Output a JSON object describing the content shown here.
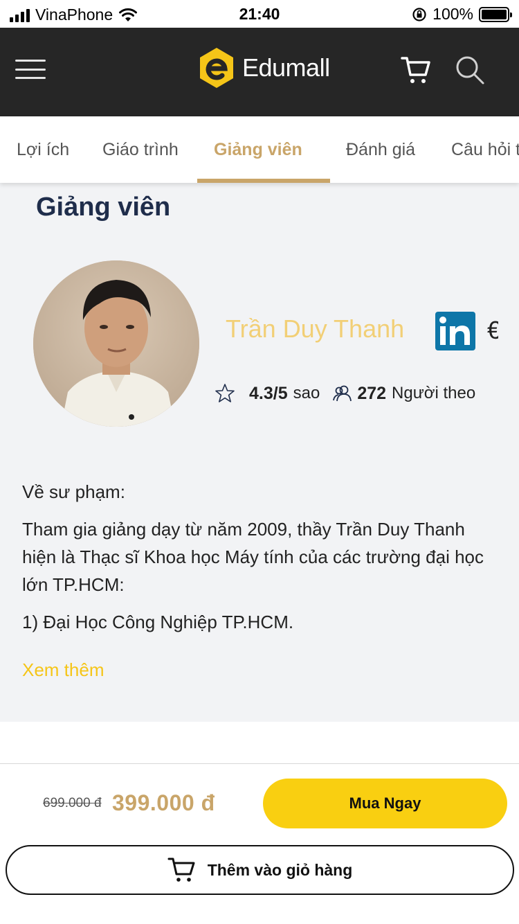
{
  "status_bar": {
    "carrier": "VinaPhone",
    "time": "21:40",
    "battery": "100%",
    "battery_level": 1.0
  },
  "header": {
    "brand": "Edumall",
    "brand_color": "#f5c518",
    "background": "#262626",
    "icons": [
      "menu-icon",
      "cart-icon",
      "search-icon"
    ]
  },
  "tabs": [
    {
      "label": "Lợi ích",
      "active": false
    },
    {
      "label": "Giáo trình",
      "active": false
    },
    {
      "label": "Giảng viên",
      "active": true
    },
    {
      "label": "Đánh giá",
      "active": false
    },
    {
      "label": "Câu hỏi t",
      "active": false
    }
  ],
  "instructor_section": {
    "title": "Giảng viên",
    "name": "Trần Duy Thanh",
    "rating_value": "4.3/5",
    "rating_unit": "sao",
    "followers_count": "272",
    "followers_label": "Người theo",
    "bio": [
      "Về sư phạm:",
      "Tham gia giảng dạy từ năm 2009, thầy Trần Duy Thanh hiện là Thạc sĩ Khoa học Máy tính của các trường đại học lớn TP.HCM:",
      "1) Đại Học Công Nghiệp TP.HCM."
    ],
    "see_more": "Xem thêm",
    "linkedin_label": "in"
  },
  "purchase": {
    "old_price": "699.000 đ",
    "new_price": "399.000 đ",
    "buy_label": "Mua Ngay",
    "add_to_cart_label": "Thêm vào giỏ hàng"
  },
  "colors": {
    "accent_gold": "#c9a569",
    "buy_yellow": "#f9cf11",
    "name_yellow": "#f2cf76",
    "linkedin_blue": "#0e76a8"
  }
}
